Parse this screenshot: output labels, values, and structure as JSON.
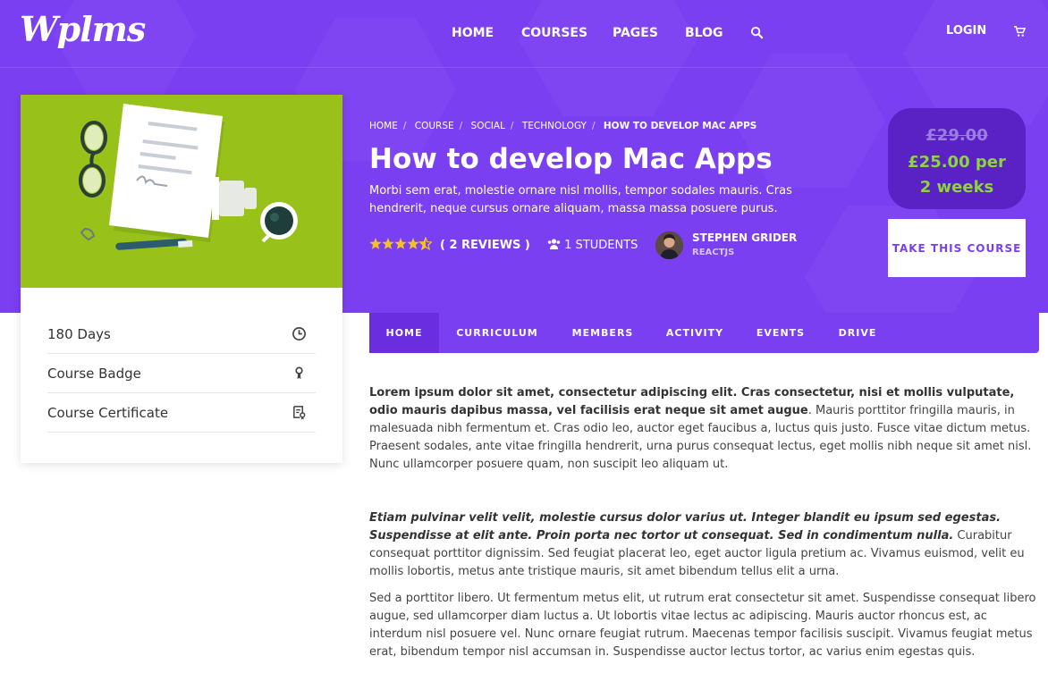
{
  "brand": {
    "logo": "Wplms"
  },
  "nav": {
    "items": [
      "HOME",
      "COURSES",
      "PAGES",
      "BLOG"
    ],
    "login": "LOGIN"
  },
  "icons": {
    "search": "search-icon",
    "cart": "cart-icon",
    "clock": "clock-icon",
    "badge": "badge-icon",
    "certificate": "certificate-icon",
    "students": "users-icon"
  },
  "colors": {
    "primary": "#7b3ff2",
    "price_box": "#5a22c4",
    "price_new": "#8bd63a",
    "star": "#f4c321",
    "thumb_bg": "#98c21a"
  },
  "breadcrumb": [
    "HOME",
    "COURSE",
    "SOCIAL",
    "TECHNOLOGY",
    "HOW TO DEVELOP MAC APPS"
  ],
  "course": {
    "title": "How to develop Mac Apps",
    "subtitle": "Morbi sem erat, molestie ornare nisl mollis, tempor sodales mauris. Cras hendrerit, neque cursus ornare aliquam, massa massa posuere purus.",
    "rating": 4.5,
    "reviews": "( 2 REVIEWS )",
    "students": "1 STUDENTS",
    "instructor": {
      "name": "STEPHEN GRIDER",
      "sub": "REACTJS"
    }
  },
  "pricing": {
    "old": "£29.00",
    "new_line1": "£25.00 per",
    "new_line2": "2 weeks",
    "cta": "TAKE THIS COURSE"
  },
  "sidebar": {
    "items": [
      {
        "label": "180 Days",
        "icon": "clock-icon"
      },
      {
        "label": "Course Badge",
        "icon": "badge-icon"
      },
      {
        "label": "Course Certificate",
        "icon": "certificate-icon"
      }
    ]
  },
  "tabs": [
    "HOME",
    "CURRICULUM",
    "MEMBERS",
    "ACTIVITY",
    "EVENTS",
    "DRIVE"
  ],
  "body": {
    "p1_bold": "Lorem ipsum dolor sit amet, consectetur adipiscing elit. Cras consectetur, nisi et mollis vulputate, odio mauris dapibus massa, vel facilisis erat neque sit amet augue",
    "p1_rest": ". Mauris porttitor fringilla mauris, in malesuada nibh fermentum et. Cras odio leo, auctor eget faucibus a, luctus quis justo. Fusce vitae dictum metus. Praesent sodales, ante vitae fringilla hendrerit, urna purus consequat lectus, eget mollis nibh neque sit amet nisl. Nunc ullamcorper posuere quam, non suscipit leo aliquam ut.",
    "p2_italic": "Etiam pulvinar velit velit, molestie cursus dolor varius ut. Integer blandit eu ipsum sed egestas. Suspendisse at elit ante. Proin porta nec tortor ut consequat. Sed in condimentum nulla.",
    "p2_rest": " Curabitur consequat porttitor dignissim. Sed feugiat placerat leo, eget auctor ligula pretium ac. Vivamus euismod, velit eu mollis lobortis, metus ante tristique mauris, sit amet bibendum tellus elit a urna.",
    "p3": "Sed a porttitor libero. Ut fermentum metus elit, ut rutrum erat consectetur sit amet. Suspendisse consequat libero augue, sed ullamcorper diam luctus a. Ut lobortis vitae lectus ac adipiscing. Mauris auctor rhoncus est, ac interdum nisl posuere vel. Nunc ornare feugiat rutrum. Maecenas tempor facilisis suscipit. Vivamus feugiat metus erat, bibendum tempor nisl accumsan in. Suspendisse auctor lectus tortor, ac varius enim egestas quis."
  }
}
